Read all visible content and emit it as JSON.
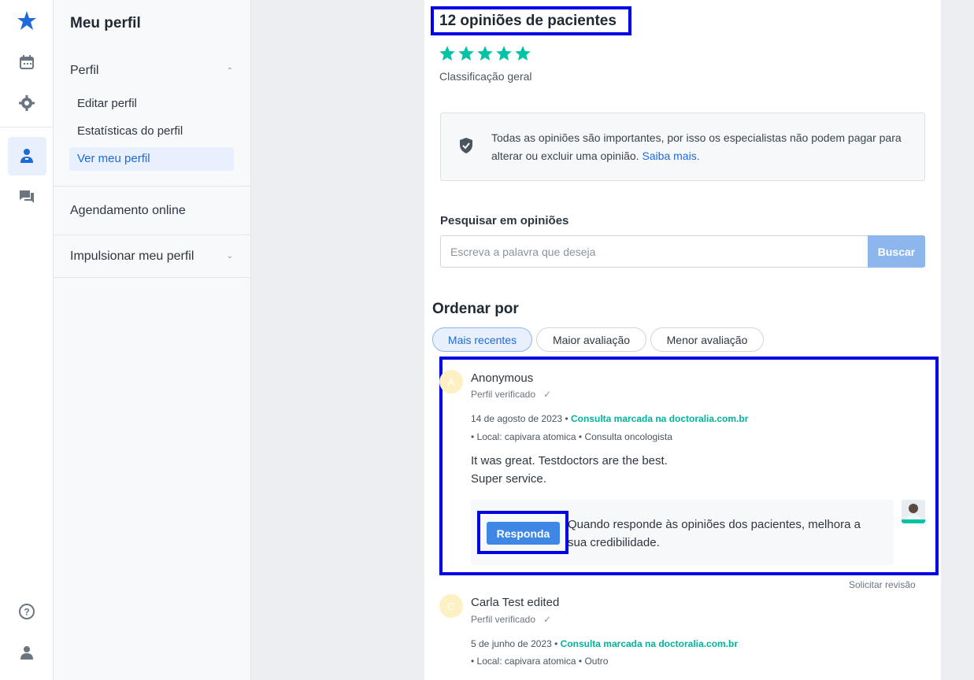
{
  "rail": {
    "icons": [
      "logo-icon",
      "calendar-icon",
      "gear-icon",
      "doctor-icon",
      "chat-icon",
      "help-icon",
      "user-icon"
    ]
  },
  "sidebar": {
    "title": "Meu perfil",
    "sections": [
      {
        "label": "Perfil",
        "expanded": true,
        "items": [
          "Editar perfil",
          "Estatísticas do perfil",
          "Ver meu perfil"
        ],
        "active_item": "Ver meu perfil"
      },
      {
        "label": "Agendamento online"
      },
      {
        "label": "Impulsionar meu perfil",
        "expanded": false
      }
    ]
  },
  "reviews": {
    "title": "12 opiniões de pacientes",
    "stars": 5,
    "rating_label": "Classificação geral",
    "info_text": "Todas as opiniões são importantes, por isso os especialistas não podem pagar para alterar ou excluir uma opinião.",
    "info_link": "Saiba mais.",
    "search_label": "Pesquisar em opiniões",
    "search_placeholder": "Escreva a palavra que deseja",
    "search_button": "Buscar",
    "sort_title": "Ordenar por",
    "sort_options": [
      "Mais recentes",
      "Maior avaliação",
      "Menor avaliação"
    ],
    "sort_active": "Mais recentes",
    "list": [
      {
        "initial": "A",
        "name": "Anonymous",
        "verified": "Perfil verificado",
        "date": "14 de agosto de 2023",
        "source": "Consulta marcada na doctoralia.com.br",
        "details": "• Local: capivara atomica • Consulta oncologista",
        "text_lines": [
          "It was great. Testdoctors are the best.",
          "Super service."
        ],
        "reply_button": "Responda",
        "reply_hint": "Quando responde às opiniões dos pacientes, melhora a sua credibilidade.",
        "request_review": "Solicitar revisão"
      },
      {
        "initial": "C",
        "name": "Carla Test edited",
        "verified": "Perfil verificado",
        "date": "5 de junho de 2023",
        "source": "Consulta marcada na doctoralia.com.br",
        "details": "• Local: capivara atomica • Outro"
      }
    ]
  },
  "colors": {
    "accent": "#1d6ad9",
    "star": "#00c3a5",
    "green_text": "#00b39b",
    "highlight": "#0000e6"
  }
}
